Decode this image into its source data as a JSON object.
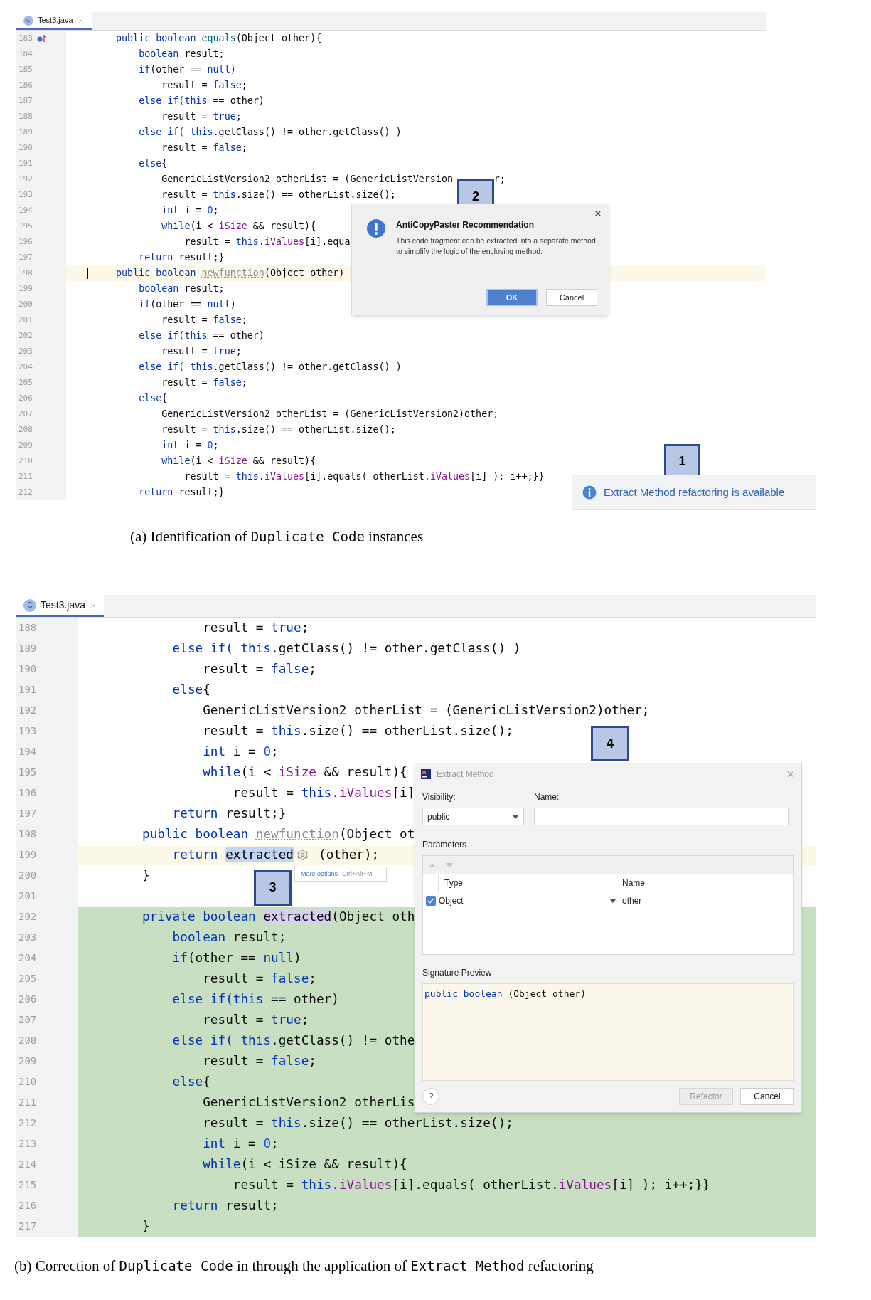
{
  "panel_a": {
    "editor": {
      "tab": {
        "icon_letter": "C",
        "label": "Test3.java",
        "selected": true
      },
      "lines": [
        {
          "number": "183",
          "override": true,
          "tokens": [
            {
              "text": "public boolean ",
              "kind": "keyword"
            },
            {
              "text": "equals",
              "kind": "method"
            },
            {
              "text": "(Object other){",
              "kind": "plain"
            }
          ]
        },
        {
          "number": "184",
          "tokens": [
            {
              "text": "    boolean ",
              "kind": "keyword"
            },
            {
              "text": "result;",
              "kind": "plain"
            }
          ]
        },
        {
          "number": "185",
          "tokens": [
            {
              "text": "    if",
              "kind": "keyword"
            },
            {
              "text": "(other == ",
              "kind": "plain"
            },
            {
              "text": "null",
              "kind": "keyword"
            },
            {
              "text": ")",
              "kind": "plain"
            }
          ]
        },
        {
          "number": "186",
          "tokens": [
            {
              "text": "        result = ",
              "kind": "plain"
            },
            {
              "text": "false",
              "kind": "keyword"
            },
            {
              "text": ";",
              "kind": "plain"
            }
          ]
        },
        {
          "number": "187",
          "tokens": [
            {
              "text": "    else if(this",
              "kind": "keyword"
            },
            {
              "text": " == other)",
              "kind": "plain"
            }
          ]
        },
        {
          "number": "188",
          "tokens": [
            {
              "text": "        result = ",
              "kind": "plain"
            },
            {
              "text": "true",
              "kind": "keyword"
            },
            {
              "text": ";",
              "kind": "plain"
            }
          ]
        },
        {
          "number": "189",
          "tokens": [
            {
              "text": "    else if( this",
              "kind": "keyword"
            },
            {
              "text": ".getClass() != other.getClass() )",
              "kind": "plain"
            }
          ]
        },
        {
          "number": "190",
          "tokens": [
            {
              "text": "        result = ",
              "kind": "plain"
            },
            {
              "text": "false",
              "kind": "keyword"
            },
            {
              "text": ";",
              "kind": "plain"
            }
          ]
        },
        {
          "number": "191",
          "tokens": [
            {
              "text": "    else",
              "kind": "keyword"
            },
            {
              "text": "{",
              "kind": "plain"
            }
          ]
        },
        {
          "number": "192",
          "tokens": [
            {
              "text": "        GenericListVersion2 otherList = (GenericListVersion",
              "kind": "plain"
            },
            {
              "text": "r;",
              "kind": "after-gap"
            }
          ]
        },
        {
          "number": "193",
          "tokens": [
            {
              "text": "        result = ",
              "kind": "plain"
            },
            {
              "text": "this",
              "kind": "keyword"
            },
            {
              "text": ".size() == otherList.size();",
              "kind": "plain"
            }
          ]
        },
        {
          "number": "194",
          "tokens": [
            {
              "text": "        int ",
              "kind": "keyword"
            },
            {
              "text": "i = ",
              "kind": "plain"
            },
            {
              "text": "0",
              "kind": "number"
            },
            {
              "text": ";",
              "kind": "plain"
            }
          ]
        },
        {
          "number": "195",
          "tokens": [
            {
              "text": "        while",
              "kind": "keyword"
            },
            {
              "text": "(i < ",
              "kind": "plain"
            },
            {
              "text": "iSize",
              "kind": "field"
            },
            {
              "text": " && result){",
              "kind": "plain"
            }
          ]
        },
        {
          "number": "196",
          "tokens": [
            {
              "text": "            result = ",
              "kind": "plain"
            },
            {
              "text": "this.",
              "kind": "keyword"
            },
            {
              "text": "iValues",
              "kind": "field"
            },
            {
              "text": "[i].equa",
              "kind": "plain"
            }
          ]
        },
        {
          "number": "197",
          "tokens": [
            {
              "text": "    return ",
              "kind": "keyword"
            },
            {
              "text": "result;}",
              "kind": "plain"
            }
          ]
        },
        {
          "number": "198",
          "current": true,
          "caret": true,
          "tokens": [
            {
              "text": "public boolean ",
              "kind": "keyword"
            },
            {
              "text": "newfunction",
              "kind": "dim"
            },
            {
              "text": "(Object other)",
              "kind": "plain"
            }
          ]
        },
        {
          "number": "199",
          "tokens": [
            {
              "text": "    boolean ",
              "kind": "keyword"
            },
            {
              "text": "result;",
              "kind": "plain"
            }
          ]
        },
        {
          "number": "200",
          "tokens": [
            {
              "text": "    if",
              "kind": "keyword"
            },
            {
              "text": "(other == ",
              "kind": "plain"
            },
            {
              "text": "null",
              "kind": "keyword"
            },
            {
              "text": ")",
              "kind": "plain"
            }
          ]
        },
        {
          "number": "201",
          "tokens": [
            {
              "text": "        result = ",
              "kind": "plain"
            },
            {
              "text": "false",
              "kind": "keyword"
            },
            {
              "text": ";",
              "kind": "plain"
            }
          ]
        },
        {
          "number": "202",
          "tokens": [
            {
              "text": "    else if(this",
              "kind": "keyword"
            },
            {
              "text": " == other)",
              "kind": "plain"
            }
          ]
        },
        {
          "number": "203",
          "tokens": [
            {
              "text": "        result = ",
              "kind": "plain"
            },
            {
              "text": "true",
              "kind": "keyword"
            },
            {
              "text": ";",
              "kind": "plain"
            }
          ]
        },
        {
          "number": "204",
          "tokens": [
            {
              "text": "    else if( this",
              "kind": "keyword"
            },
            {
              "text": ".getClass() != other.getClass() )",
              "kind": "plain"
            }
          ]
        },
        {
          "number": "205",
          "tokens": [
            {
              "text": "        result = ",
              "kind": "plain"
            },
            {
              "text": "false",
              "kind": "keyword"
            },
            {
              "text": ";",
              "kind": "plain"
            }
          ]
        },
        {
          "number": "206",
          "tokens": [
            {
              "text": "    else",
              "kind": "keyword"
            },
            {
              "text": "{",
              "kind": "plain"
            }
          ]
        },
        {
          "number": "207",
          "tokens": [
            {
              "text": "        GenericListVersion2 otherList = (GenericListVersion2)other;",
              "kind": "plain"
            }
          ]
        },
        {
          "number": "208",
          "tokens": [
            {
              "text": "        result = ",
              "kind": "plain"
            },
            {
              "text": "this",
              "kind": "keyword"
            },
            {
              "text": ".size() == otherList.size();",
              "kind": "plain"
            }
          ]
        },
        {
          "number": "209",
          "tokens": [
            {
              "text": "        int ",
              "kind": "keyword"
            },
            {
              "text": "i = ",
              "kind": "plain"
            },
            {
              "text": "0",
              "kind": "number"
            },
            {
              "text": ";",
              "kind": "plain"
            }
          ]
        },
        {
          "number": "210",
          "tokens": [
            {
              "text": "        while",
              "kind": "keyword"
            },
            {
              "text": "(i < ",
              "kind": "plain"
            },
            {
              "text": "iSize",
              "kind": "field"
            },
            {
              "text": " && result){",
              "kind": "plain"
            }
          ]
        },
        {
          "number": "211",
          "tokens": [
            {
              "text": "            result = ",
              "kind": "plain"
            },
            {
              "text": "this.",
              "kind": "keyword"
            },
            {
              "text": "iValues",
              "kind": "field"
            },
            {
              "text": "[i].equals( otherList.",
              "kind": "plain"
            },
            {
              "text": "iValues",
              "kind": "field"
            },
            {
              "text": "[i] ); i++;}}",
              "kind": "plain"
            }
          ]
        },
        {
          "number": "212",
          "tokens": [
            {
              "text": "    return ",
              "kind": "keyword"
            },
            {
              "text": "result;}",
              "kind": "plain"
            }
          ]
        }
      ]
    },
    "recommendation": {
      "marker": "2",
      "title": "AntiCopyPaster Recommendation",
      "message": "This code fragment can be extracted into a separate method to simplify the logic of the enclosing method.",
      "buttons": [
        {
          "label": "OK",
          "default": true
        },
        {
          "label": "Cancel",
          "default": false
        }
      ]
    },
    "notification": {
      "marker": "1",
      "text": "Extract Method refactoring is available"
    },
    "caption": [
      {
        "text": "(a) Identification of ",
        "kind": "plain"
      },
      {
        "text": "Duplicate Code",
        "kind": "code"
      },
      {
        "text": " instances",
        "kind": "plain"
      }
    ]
  },
  "panel_b": {
    "editor": {
      "tab": {
        "icon_letter": "C",
        "label": "Test3.java",
        "selected": true
      },
      "lines": [
        {
          "number": "188",
          "tokens": [
            {
              "text": "        result = ",
              "kind": "plain"
            },
            {
              "text": "true",
              "kind": "keyword"
            },
            {
              "text": ";",
              "kind": "plain"
            }
          ]
        },
        {
          "number": "189",
          "tokens": [
            {
              "text": "    else if( this",
              "kind": "keyword"
            },
            {
              "text": ".getClass() != other.getClass() )",
              "kind": "plain"
            }
          ]
        },
        {
          "number": "190",
          "tokens": [
            {
              "text": "        result = ",
              "kind": "plain"
            },
            {
              "text": "false",
              "kind": "keyword"
            },
            {
              "text": ";",
              "kind": "plain"
            }
          ]
        },
        {
          "number": "191",
          "tokens": [
            {
              "text": "    else",
              "kind": "keyword"
            },
            {
              "text": "{",
              "kind": "plain"
            }
          ]
        },
        {
          "number": "192",
          "tokens": [
            {
              "text": "        GenericListVersion2 otherList = (GenericListVersion2)other;",
              "kind": "plain"
            }
          ]
        },
        {
          "number": "193",
          "tokens": [
            {
              "text": "        result = ",
              "kind": "plain"
            },
            {
              "text": "this",
              "kind": "keyword"
            },
            {
              "text": ".size() == otherList.size();",
              "kind": "plain"
            }
          ]
        },
        {
          "number": "194",
          "tokens": [
            {
              "text": "        int ",
              "kind": "keyword"
            },
            {
              "text": "i = ",
              "kind": "plain"
            },
            {
              "text": "0",
              "kind": "number"
            },
            {
              "text": ";",
              "kind": "plain"
            }
          ]
        },
        {
          "number": "195",
          "tokens": [
            {
              "text": "        while",
              "kind": "keyword"
            },
            {
              "text": "(i < ",
              "kind": "plain"
            },
            {
              "text": "iSize",
              "kind": "field"
            },
            {
              "text": " && result){",
              "kind": "plain"
            }
          ]
        },
        {
          "number": "196",
          "tokens": [
            {
              "text": "            result = ",
              "kind": "plain"
            },
            {
              "text": "this.",
              "kind": "keyword"
            },
            {
              "text": "iValues",
              "kind": "field"
            },
            {
              "text": "[i]",
              "kind": "plain"
            }
          ]
        },
        {
          "number": "197",
          "tokens": [
            {
              "text": "    return ",
              "kind": "keyword"
            },
            {
              "text": "result;}",
              "kind": "plain"
            }
          ]
        },
        {
          "number": "198",
          "tokens": [
            {
              "text": "public boolean ",
              "kind": "keyword"
            },
            {
              "text": "newfunction",
              "kind": "dim"
            },
            {
              "text": "(Object ot",
              "kind": "plain"
            }
          ]
        },
        {
          "number": "199",
          "current": true,
          "tokens": [
            {
              "text": "    return ",
              "kind": "keyword"
            },
            {
              "text": "extracted",
              "kind": "selected"
            },
            {
              "kind": "gear"
            },
            {
              "text": " (other);",
              "kind": "plain"
            }
          ]
        },
        {
          "number": "200",
          "tokens": [
            {
              "text": "}",
              "kind": "plain"
            }
          ]
        },
        {
          "number": "201"
        },
        {
          "number": "202",
          "inserted": true,
          "tokens": [
            {
              "text": "private boolean ",
              "kind": "keyword"
            },
            {
              "text": "extracted",
              "kind": "target"
            },
            {
              "text": "(Object oth",
              "kind": "plain"
            }
          ]
        },
        {
          "number": "203",
          "inserted": true,
          "tokens": [
            {
              "text": "    boolean ",
              "kind": "keyword"
            },
            {
              "text": "result;",
              "kind": "plain"
            }
          ]
        },
        {
          "number": "204",
          "inserted": true,
          "tokens": [
            {
              "text": "    if",
              "kind": "keyword"
            },
            {
              "text": "(other == ",
              "kind": "plain"
            },
            {
              "text": "null",
              "kind": "keyword"
            },
            {
              "text": ")",
              "kind": "plain"
            }
          ]
        },
        {
          "number": "205",
          "inserted": true,
          "tokens": [
            {
              "text": "        result = ",
              "kind": "plain"
            },
            {
              "text": "false",
              "kind": "keyword"
            },
            {
              "text": ";",
              "kind": "plain"
            }
          ]
        },
        {
          "number": "206",
          "inserted": true,
          "tokens": [
            {
              "text": "    else if(this",
              "kind": "keyword"
            },
            {
              "text": " == other)",
              "kind": "plain"
            }
          ]
        },
        {
          "number": "207",
          "inserted": true,
          "tokens": [
            {
              "text": "        result = ",
              "kind": "plain"
            },
            {
              "text": "true",
              "kind": "keyword"
            },
            {
              "text": ";",
              "kind": "plain"
            }
          ]
        },
        {
          "number": "208",
          "inserted": true,
          "tokens": [
            {
              "text": "    else if( this",
              "kind": "keyword"
            },
            {
              "text": ".getClass() != othe",
              "kind": "plain"
            }
          ]
        },
        {
          "number": "209",
          "inserted": true,
          "tokens": [
            {
              "text": "        result = ",
              "kind": "plain"
            },
            {
              "text": "false",
              "kind": "keyword"
            },
            {
              "text": ";",
              "kind": "plain"
            }
          ]
        },
        {
          "number": "210",
          "inserted": true,
          "tokens": [
            {
              "text": "    else",
              "kind": "keyword"
            },
            {
              "text": "{",
              "kind": "plain"
            }
          ]
        },
        {
          "number": "211",
          "inserted": true,
          "tokens": [
            {
              "text": "        GenericListVersion2 otherLis",
              "kind": "plain"
            }
          ]
        },
        {
          "number": "212",
          "inserted": true,
          "tokens": [
            {
              "text": "        result = ",
              "kind": "plain"
            },
            {
              "text": "this",
              "kind": "keyword"
            },
            {
              "text": ".size() == otherList.size();",
              "kind": "plain"
            }
          ]
        },
        {
          "number": "213",
          "inserted": true,
          "tokens": [
            {
              "text": "        int ",
              "kind": "keyword"
            },
            {
              "text": "i = ",
              "kind": "plain"
            },
            {
              "text": "0",
              "kind": "number"
            },
            {
              "text": ";",
              "kind": "plain"
            }
          ]
        },
        {
          "number": "214",
          "inserted": true,
          "tokens": [
            {
              "text": "        while",
              "kind": "keyword"
            },
            {
              "text": "(i < iSize && result){",
              "kind": "plain"
            }
          ]
        },
        {
          "number": "215",
          "inserted": true,
          "tokens": [
            {
              "text": "            result = ",
              "kind": "plain"
            },
            {
              "text": "this.",
              "kind": "keyword"
            },
            {
              "text": "iValues",
              "kind": "field"
            },
            {
              "text": "[i].equals( otherList.",
              "kind": "plain"
            },
            {
              "text": "iValues",
              "kind": "field"
            },
            {
              "text": "[i] ); i++;}}",
              "kind": "plain"
            }
          ]
        },
        {
          "number": "216",
          "inserted": true,
          "tokens": [
            {
              "text": "    return ",
              "kind": "keyword"
            },
            {
              "text": "result;",
              "kind": "plain"
            }
          ]
        },
        {
          "number": "217",
          "inserted": true,
          "tokens": [
            {
              "text": "}",
              "kind": "plain"
            }
          ]
        }
      ]
    },
    "more_options": {
      "marker": "3",
      "text": "More options",
      "shortcut": "Ctrl+Alt+M"
    },
    "extract_dialog": {
      "marker": "4",
      "title": "Extract Method",
      "visibility_label": "Visibility:",
      "visibility": "public",
      "name_label": "Name:",
      "parameters_label": "Parameters",
      "columns": [
        "Type",
        "Name"
      ],
      "parameters": [
        {
          "checked": true,
          "type": "Object",
          "name": "other"
        }
      ],
      "signature_label": "Signature Preview",
      "signature": [
        {
          "text": "public boolean ",
          "kind": "keyword"
        },
        {
          "text": "(Object other)",
          "kind": "plain"
        }
      ],
      "help": "?",
      "buttons": [
        {
          "label": "Refactor",
          "disabled": true
        },
        {
          "label": "Cancel",
          "disabled": false
        }
      ]
    },
    "caption": [
      {
        "text": "(b) Correction of ",
        "kind": "plain"
      },
      {
        "text": "Duplicate Code",
        "kind": "code"
      },
      {
        "text": " in through the application of ",
        "kind": "plain"
      },
      {
        "text": "Extract Method",
        "kind": "code"
      },
      {
        "text": " refactoring",
        "kind": "plain"
      }
    ]
  }
}
